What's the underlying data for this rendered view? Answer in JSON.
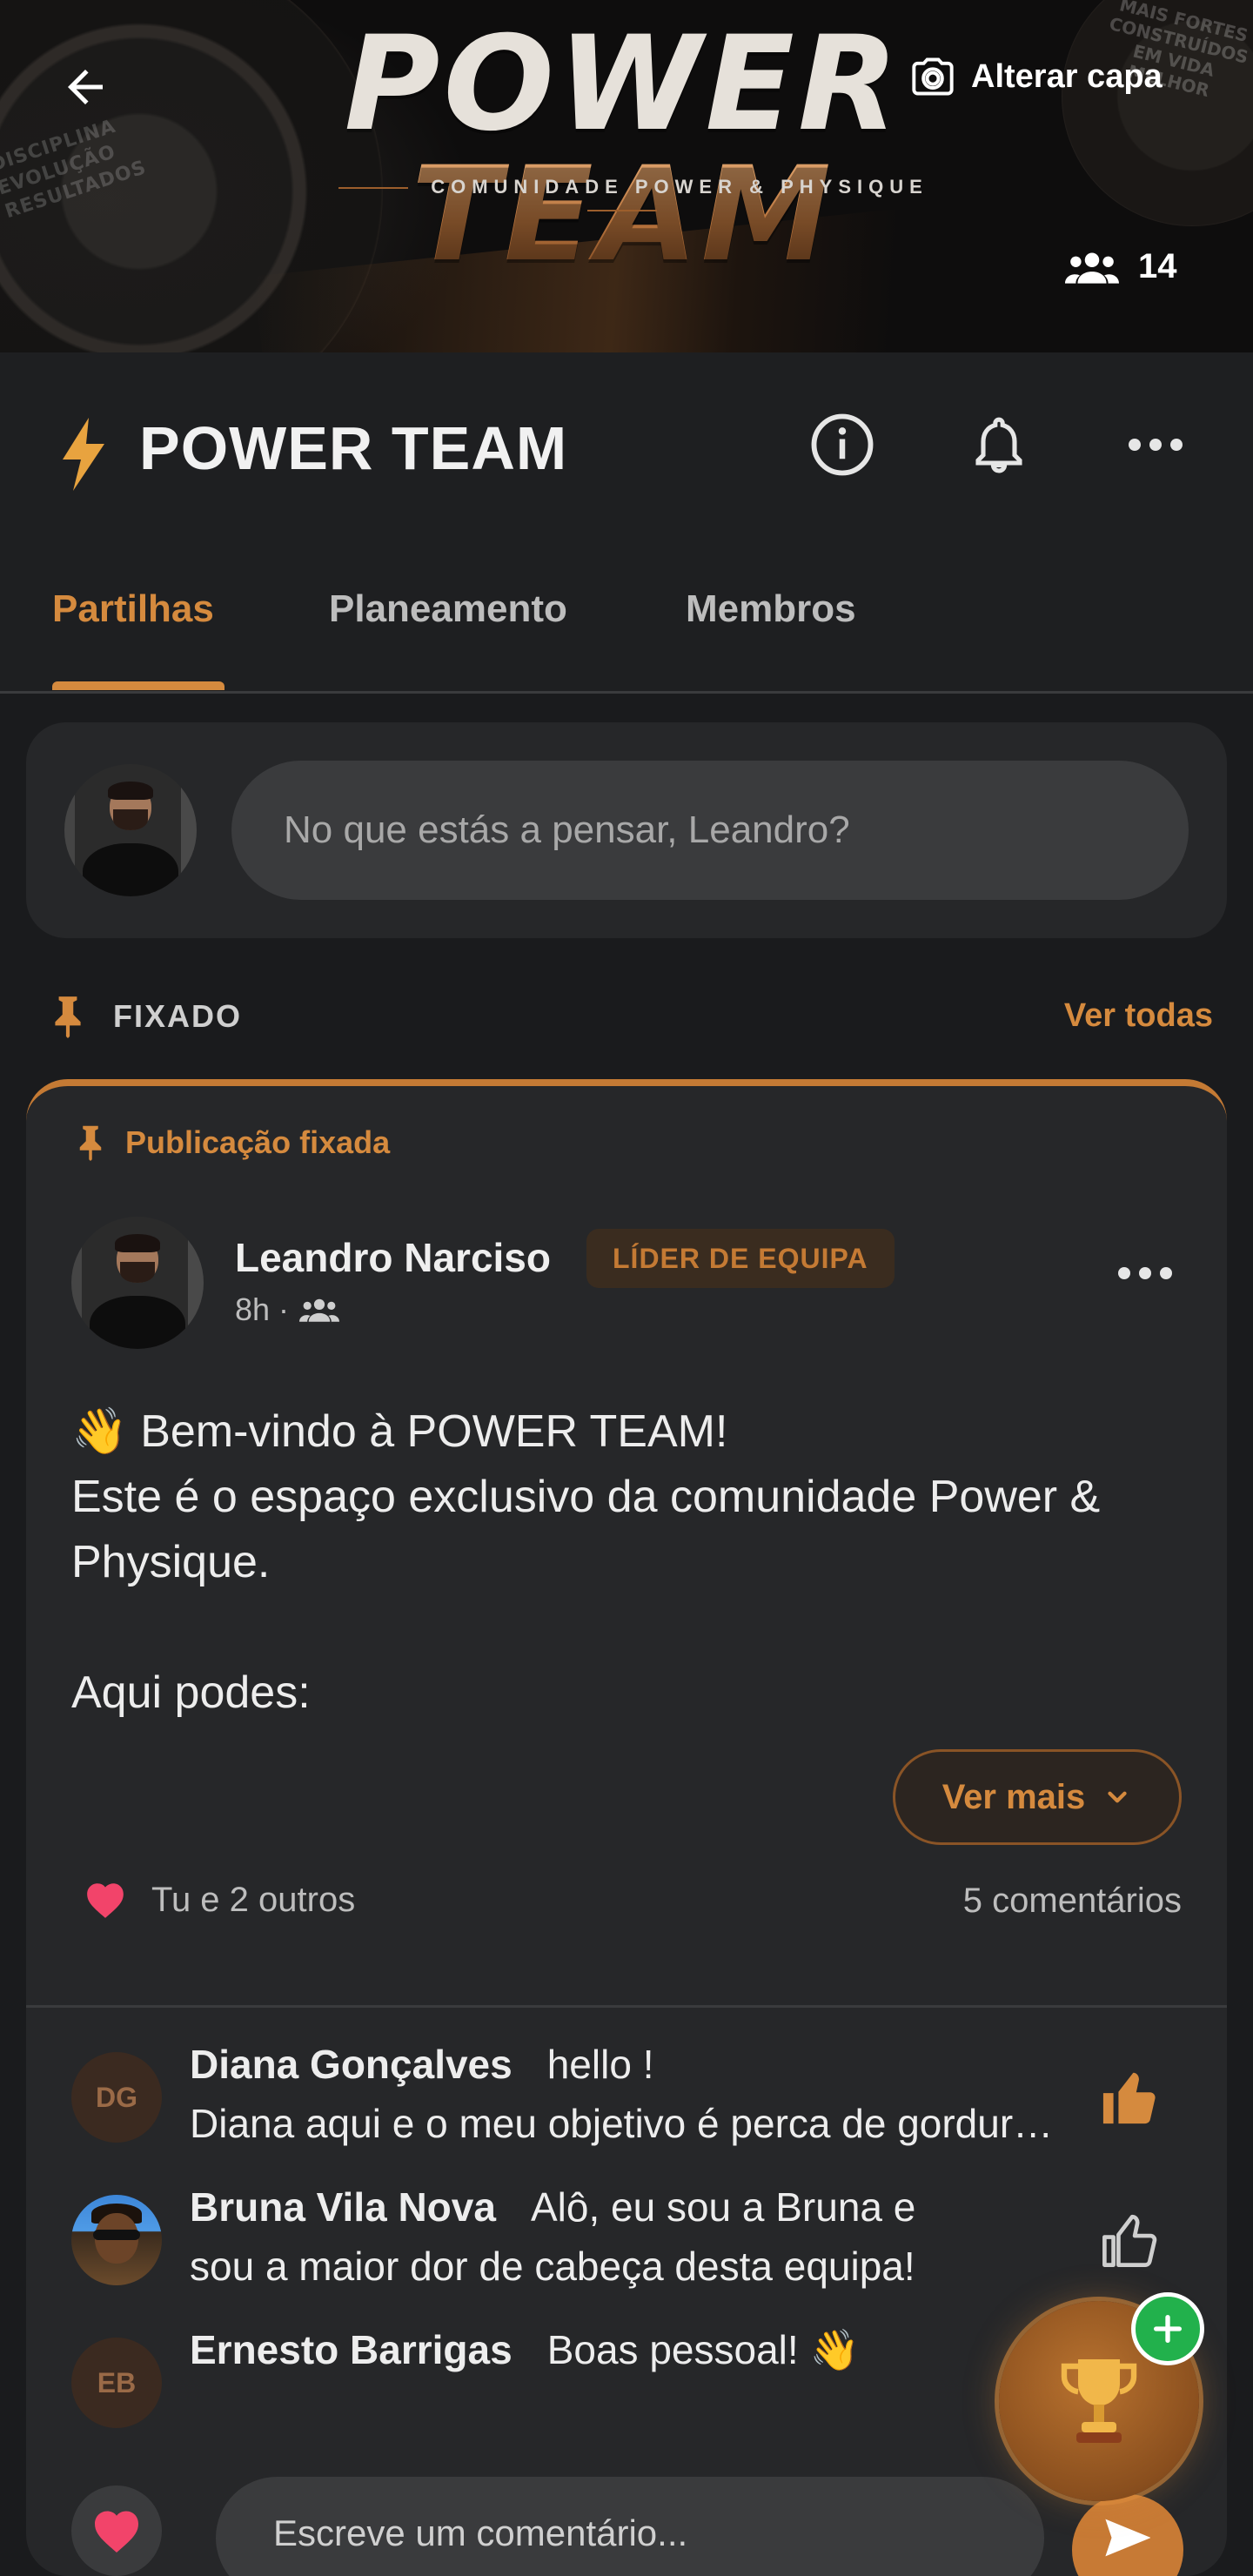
{
  "cover": {
    "brand_word1": "POWER",
    "brand_word2": "TEAM",
    "tagline": "COMUNIDADE POWER & PHYSIQUE",
    "side_text_left": "DISCIPLINA\nEVOLUÇÃO\nRESULTADOS",
    "side_text_right": "MAIS FORTES\nCONSTRUÍDOS\nEM VIDA\nMELHOR",
    "change_cover_label": "Alterar capa",
    "members_count": "14"
  },
  "header": {
    "title": "POWER TEAM",
    "icons": [
      "bolt-icon",
      "info-icon",
      "bell-icon",
      "more-icon"
    ]
  },
  "tabs": [
    {
      "label": "Partilhas",
      "active": true
    },
    {
      "label": "Planeamento",
      "active": false
    },
    {
      "label": "Membros",
      "active": false
    }
  ],
  "composer": {
    "placeholder": "No que estás a pensar, Leandro?"
  },
  "pinned_section": {
    "label": "FIXADO",
    "see_all": "Ver todas"
  },
  "post": {
    "pinned_tag": "Publicação fixada",
    "author": "Leandro Narciso",
    "role_badge": "LÍDER DE EQUIPA",
    "time": "8h ·",
    "body": "👋 Bem-vindo à POWER TEAM!\nEste é o espaço exclusivo da comunidade Power & Physique.\n\nAqui podes:",
    "see_more": "Ver mais",
    "reactions": "Tu e 2 outros",
    "comments_count": "5 comentários"
  },
  "comments": [
    {
      "initials": "DG",
      "name": "Diana Gonçalves",
      "text_line1": "hello !",
      "text_line2": "Diana aqui e o meu objetivo é perca de gordura e ganho de massa"
    },
    {
      "initials": "",
      "name": "Bruna Vila Nova",
      "text_line1": "Alô, eu sou a Bruna e",
      "text_line2": "sou a maior dor de cabeça desta equipa!"
    },
    {
      "initials": "EB",
      "name": "Ernesto Barrigas",
      "text_line1": "Boas pessoal! 👋",
      "text_line2": ""
    }
  ],
  "comment_bar": {
    "placeholder": "Escreve um comentário..."
  },
  "colors": {
    "accent": "#d58a3e",
    "background": "#1a1b1d",
    "card": "#262729",
    "fab_plus": "#22b14c"
  }
}
